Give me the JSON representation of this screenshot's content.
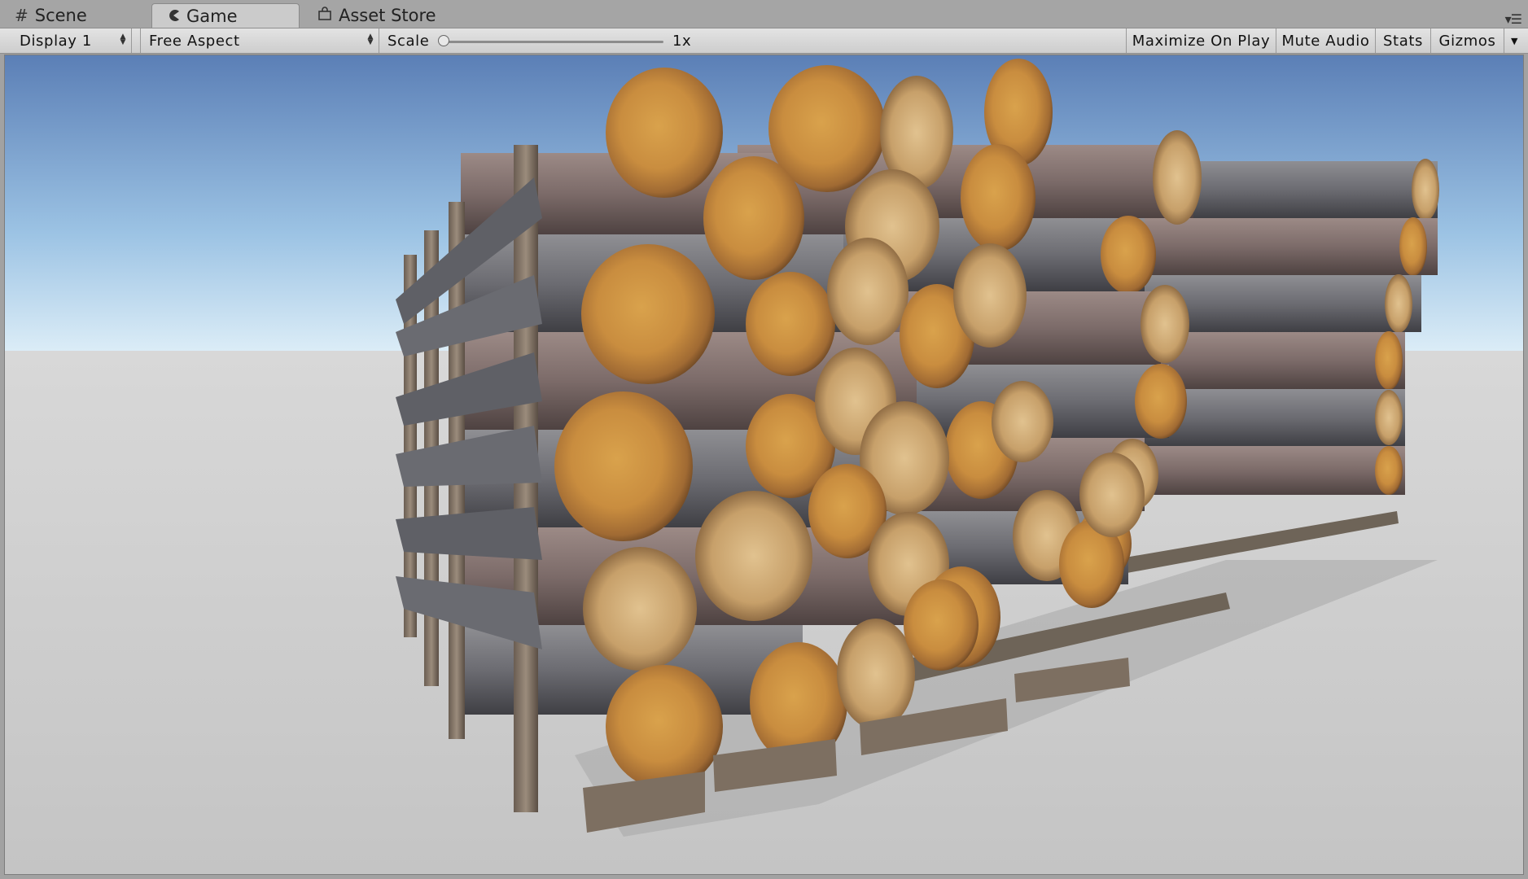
{
  "tabs": [
    {
      "label": "Scene",
      "icon": "grid-icon"
    },
    {
      "label": "Game",
      "icon": "pacman-icon",
      "active": true
    },
    {
      "label": "Asset Store",
      "icon": "shopping-bag-icon"
    }
  ],
  "toolbar": {
    "display": "Display 1",
    "aspect": "Free Aspect",
    "scale_label": "Scale",
    "scale_value": "1x",
    "maximize_on_play": "Maximize On Play",
    "mute_audio": "Mute Audio",
    "stats": "Stats",
    "gizmos": "Gizmos"
  },
  "viewport": {
    "sky_top": "#5f83b8",
    "sky_horizon": "#d7ebf6",
    "ground": "#c9c9c9",
    "description_icon": "log-pile-scene"
  }
}
